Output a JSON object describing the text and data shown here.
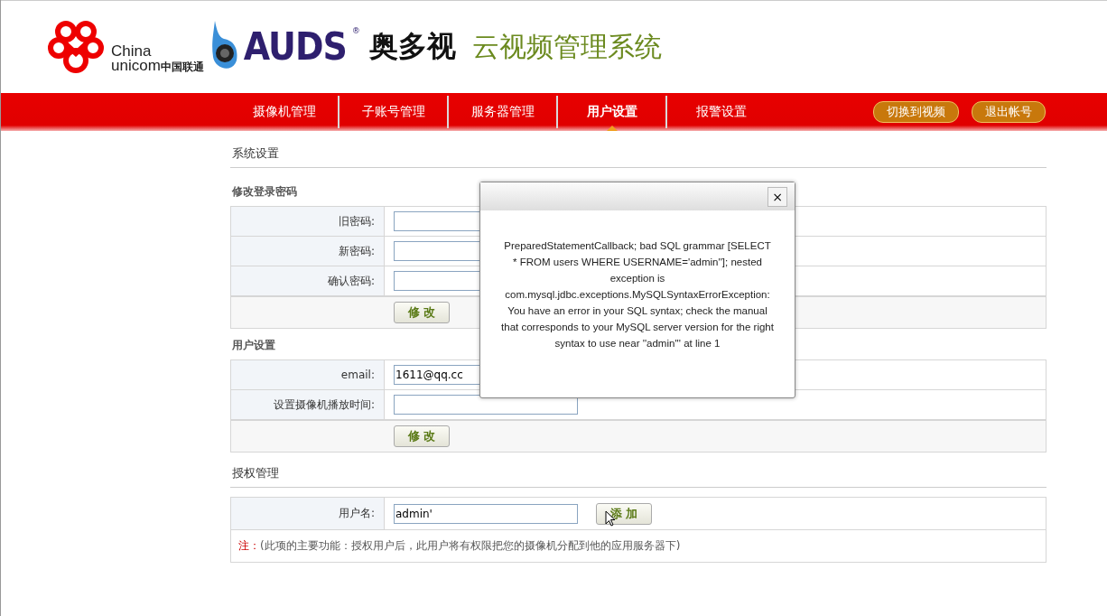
{
  "header": {
    "unicom": {
      "line1": "China",
      "line2": "unicom",
      "name": "中国联通"
    },
    "brand": {
      "name": "AUDS",
      "mark": "®",
      "cn": "奥多视"
    },
    "title": "云视频管理系统"
  },
  "nav": {
    "items": [
      {
        "label": "摄像机管理",
        "selected": false
      },
      {
        "label": "子账号管理",
        "selected": false
      },
      {
        "label": "服务器管理",
        "selected": false
      },
      {
        "label": "用户设置",
        "selected": true
      },
      {
        "label": "报警设置",
        "selected": false
      }
    ],
    "actions": [
      "切换到视频",
      "退出帐号"
    ]
  },
  "page_title": "系统设置",
  "sections": [
    {
      "heading": "修改登录密码",
      "fields": [
        {
          "label": "旧密码:"
        },
        {
          "label": "新密码:"
        },
        {
          "label": "确认密码:"
        }
      ],
      "button": "修 改"
    },
    {
      "heading": "用户设置",
      "fields": [
        {
          "label": "email:",
          "value": "1611@qq.cc"
        },
        {
          "label": "设置摄像机播放时间:"
        }
      ],
      "button": "修 改"
    }
  ],
  "auth": {
    "heading": "授权管理",
    "field": {
      "label": "用户名:",
      "value": "admin'"
    },
    "button": "添 加",
    "note": {
      "prefix": "注：",
      "text": "(此项的主要功能：授权用户后，此用户将有权限把您的摄像机分配到他的应用服务器下)"
    }
  },
  "dialog": {
    "close": "×",
    "message": "PreparedStatementCallback; bad SQL grammar [SELECT * FROM users WHERE USERNAME='admin'']; nested exception is com.mysql.jdbc.exceptions.MySQLSyntaxErrorException: You have an error in your SQL syntax; check the manual that corresponds to your MySQL server version for the right syntax to use near ''admin''' at line 1"
  }
}
